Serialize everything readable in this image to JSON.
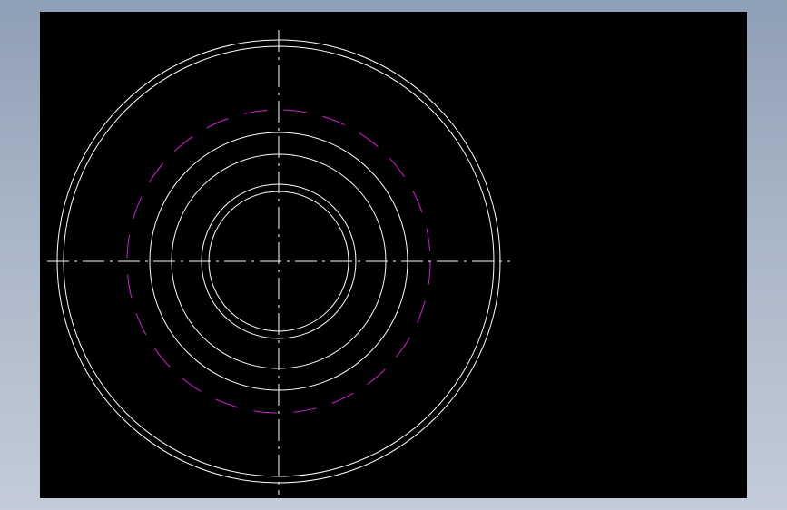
{
  "scene": {
    "background_gradient": [
      "#8f9fb5",
      "#c3ccd8"
    ],
    "viewport_color": "#000000",
    "line_color": "#ffffff",
    "hidden_line_color": "#d020d0"
  },
  "drawing": {
    "type": "cad-concentric-circles",
    "circle_count": 8,
    "solid_circle_count": 7,
    "dashed_circle_count": 1,
    "centerlines": 2
  }
}
